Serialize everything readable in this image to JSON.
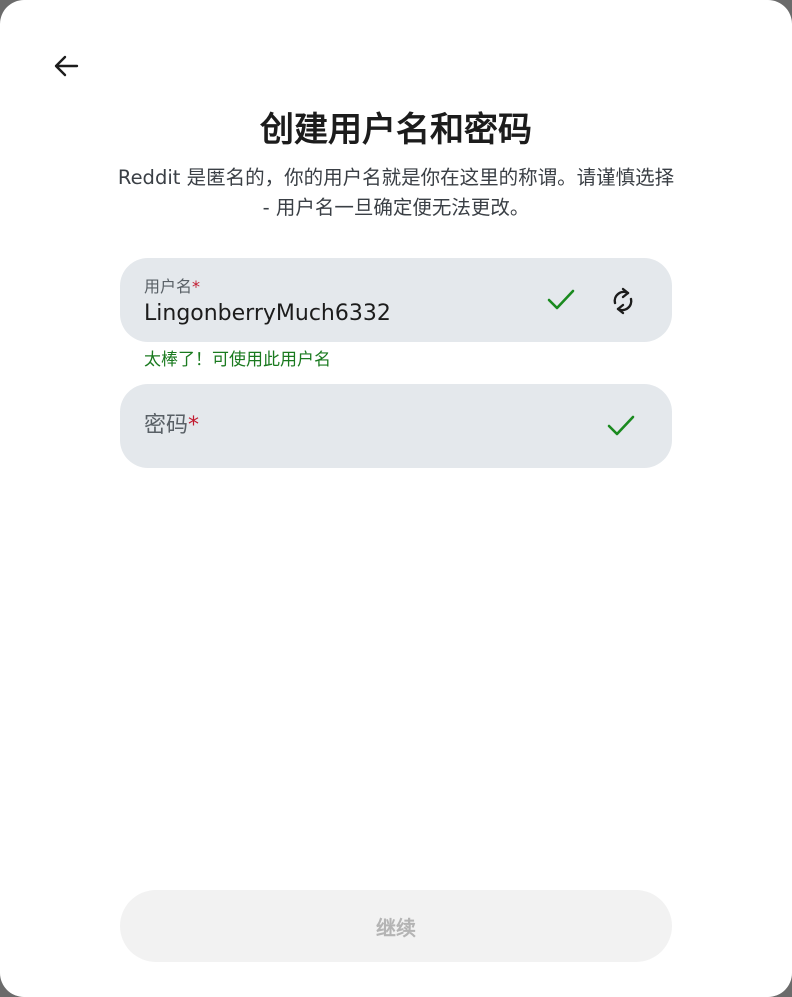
{
  "header": {
    "back_icon": "arrow-left-icon",
    "title": "创建用户名和密码",
    "subtitle": "Reddit 是匿名的，你的用户名就是你在这里的称谓。请谨慎选择 - 用户名一旦确定便无法更改。"
  },
  "username_field": {
    "label": "用户名",
    "required_mark": "*",
    "value": "LingonberryMuch6332",
    "valid_icon": "checkmark-icon",
    "refresh_icon": "refresh-icon",
    "helper_text": "太棒了！可使用此用户名"
  },
  "password_field": {
    "placeholder": "密码",
    "required_mark": "*",
    "valid_icon": "checkmark-icon"
  },
  "footer": {
    "continue_label": "继续"
  },
  "colors": {
    "field_bg": "#e4e8ec",
    "success": "#1a7a1f",
    "required": "#c21a2f",
    "disabled_button_bg": "#f2f2f2",
    "disabled_button_text": "#b4b4b4"
  }
}
